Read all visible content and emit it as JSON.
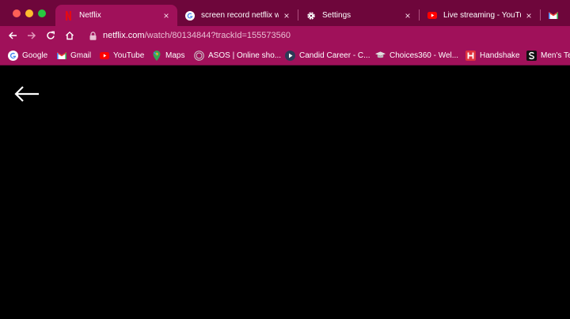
{
  "tabs": [
    {
      "title": "Netflix",
      "icon": "netflix-icon",
      "active": true
    },
    {
      "title": "screen record netflix with",
      "icon": "google-icon"
    },
    {
      "title": "Settings",
      "icon": "gear-icon"
    },
    {
      "title": "Live streaming - YouTube",
      "icon": "youtube-icon"
    },
    {
      "title": "",
      "icon": "gmail-icon"
    }
  ],
  "omnibox": {
    "host": "netflix.com",
    "path": "/watch/80134844?trackId=155573560"
  },
  "bookmarks": [
    {
      "label": "Google",
      "icon": "google-icon"
    },
    {
      "label": "Gmail",
      "icon": "gmail-icon"
    },
    {
      "label": "YouTube",
      "icon": "youtube-icon"
    },
    {
      "label": "Maps",
      "icon": "maps-icon"
    },
    {
      "label": "ASOS | Online sho...",
      "icon": "asos-icon"
    },
    {
      "label": "Candid Career - C...",
      "icon": "candid-career-icon"
    },
    {
      "label": "Choices360 - Wel...",
      "icon": "choices360-icon"
    },
    {
      "label": "Handshake",
      "icon": "handshake-icon"
    },
    {
      "label": "Men's Te",
      "icon": "s-icon"
    }
  ],
  "colors": {
    "frame": "#6e063b",
    "toolbar": "#a0115a",
    "content": "#000000"
  }
}
